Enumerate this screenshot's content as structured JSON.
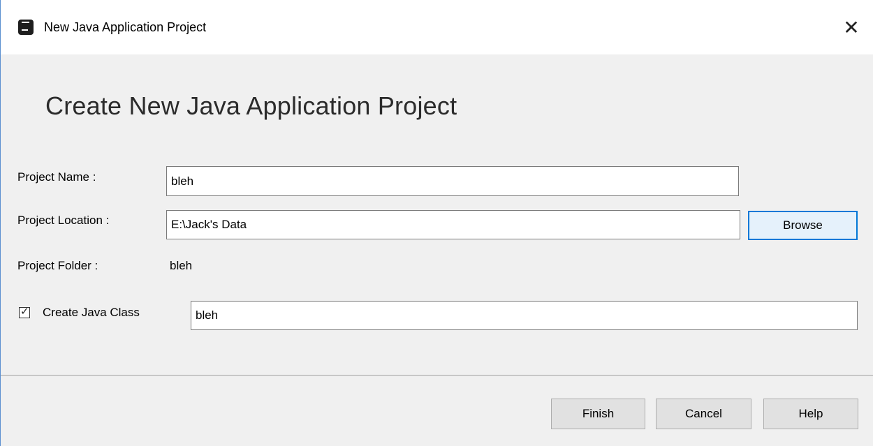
{
  "window": {
    "title": "New Java Application Project",
    "close_glyph": "✕"
  },
  "heading": "Create New Java Application Project",
  "form": {
    "project_name_label": "Project Name :",
    "project_name_value": "bleh",
    "project_location_label": "Project Location :",
    "project_location_value": "E:\\Jack's Data",
    "browse_label": "Browse",
    "project_folder_label": "Project Folder :",
    "project_folder_value": "bleh",
    "create_class_label": "Create Java Class",
    "create_class_checked": true,
    "create_class_value": "bleh"
  },
  "footer": {
    "finish_label": "Finish",
    "cancel_label": "Cancel",
    "help_label": "Help"
  },
  "colors": {
    "accent": "#0078d7",
    "window_bg": "#f0f0f0"
  },
  "icons": {
    "app": "app-logo-icon",
    "close": "close-icon",
    "check": "checkmark-icon"
  }
}
